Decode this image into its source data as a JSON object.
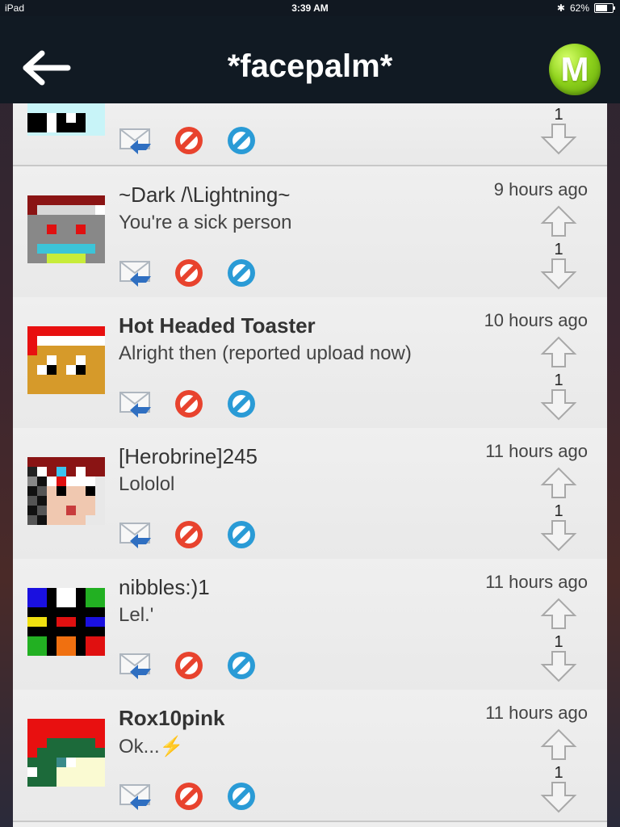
{
  "status_bar": {
    "device": "iPad",
    "time": "3:39 AM",
    "battery": "62%"
  },
  "nav": {
    "title": "*facepalm*",
    "logo_letter": "M"
  },
  "colors": {
    "navbar": "#111a23",
    "logo_green": "#8fd31c",
    "block_red": "#e8432e",
    "report_blue": "#2a9bd6"
  },
  "comments": [
    {
      "username": "",
      "message": "",
      "time": "",
      "votes": "1"
    },
    {
      "username": "~Dark /\\Lightning~",
      "message": "You're a sick person",
      "time": "9 hours ago",
      "votes": "1"
    },
    {
      "username": "Hot Headed Toaster",
      "message": "Alright then (reported upload now)",
      "time": "10 hours ago",
      "votes": "1"
    },
    {
      "username": "[Herobrine]245",
      "message": "Lololol",
      "time": "11 hours ago",
      "votes": "1"
    },
    {
      "username": "nibbles:)1",
      "message": "Lel.'",
      "time": "11 hours ago",
      "votes": "1"
    },
    {
      "username": "Rox10pink",
      "message": "Ok...⚡",
      "time": "11 hours ago",
      "votes": "1"
    }
  ]
}
